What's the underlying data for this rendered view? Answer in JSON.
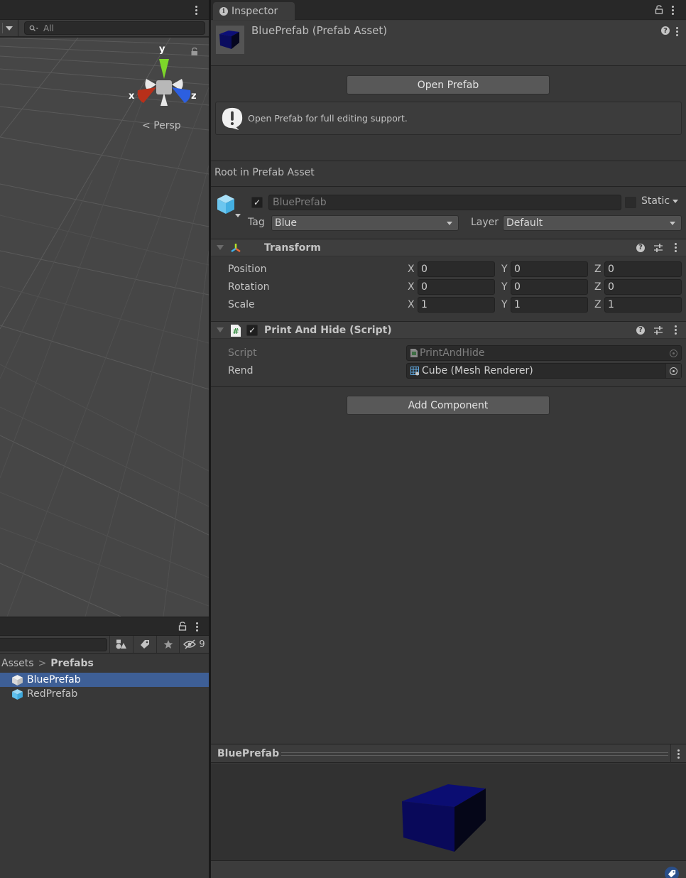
{
  "scene": {
    "search_placeholder": "All",
    "gizmo": {
      "y_label": "y",
      "x_label": "x",
      "z_label": "z"
    },
    "projection_label": "Persp",
    "colors": {
      "x_axis": "#c0341d",
      "y_axis": "#7dd62a",
      "z_axis": "#2c5fe0"
    }
  },
  "project": {
    "hidden_count": "9",
    "breadcrumb": {
      "root": "Assets",
      "current": "Prefabs"
    },
    "assets": [
      {
        "name": "BluePrefab",
        "selected": true
      },
      {
        "name": "RedPrefab",
        "selected": false
      }
    ]
  },
  "inspector": {
    "tab_label": "Inspector",
    "asset_title": "BluePrefab (Prefab Asset)",
    "open_prefab_label": "Open Prefab",
    "help_message": "Open Prefab for full editing support.",
    "root_label": "Root in Prefab Asset",
    "gameobject": {
      "active": true,
      "name": "BluePrefab",
      "static_label": "Static",
      "static": false,
      "tag_label": "Tag",
      "tag_value": "Blue",
      "layer_label": "Layer",
      "layer_value": "Default"
    },
    "transform": {
      "title": "Transform",
      "rows": [
        {
          "label": "Position",
          "x": "0",
          "y": "0",
          "z": "0"
        },
        {
          "label": "Rotation",
          "x": "0",
          "y": "0",
          "z": "0"
        },
        {
          "label": "Scale",
          "x": "1",
          "y": "1",
          "z": "1"
        }
      ],
      "axis_labels": {
        "x": "X",
        "y": "Y",
        "z": "Z"
      }
    },
    "script_component": {
      "title": "Print And Hide (Script)",
      "enabled": true,
      "script_label": "Script",
      "script_value": "PrintAndHide",
      "rend_label": "Rend",
      "rend_value": "Cube (Mesh Renderer)"
    },
    "add_component_label": "Add Component",
    "preview_title": "BluePrefab",
    "accent_color": "#3e5f96"
  }
}
